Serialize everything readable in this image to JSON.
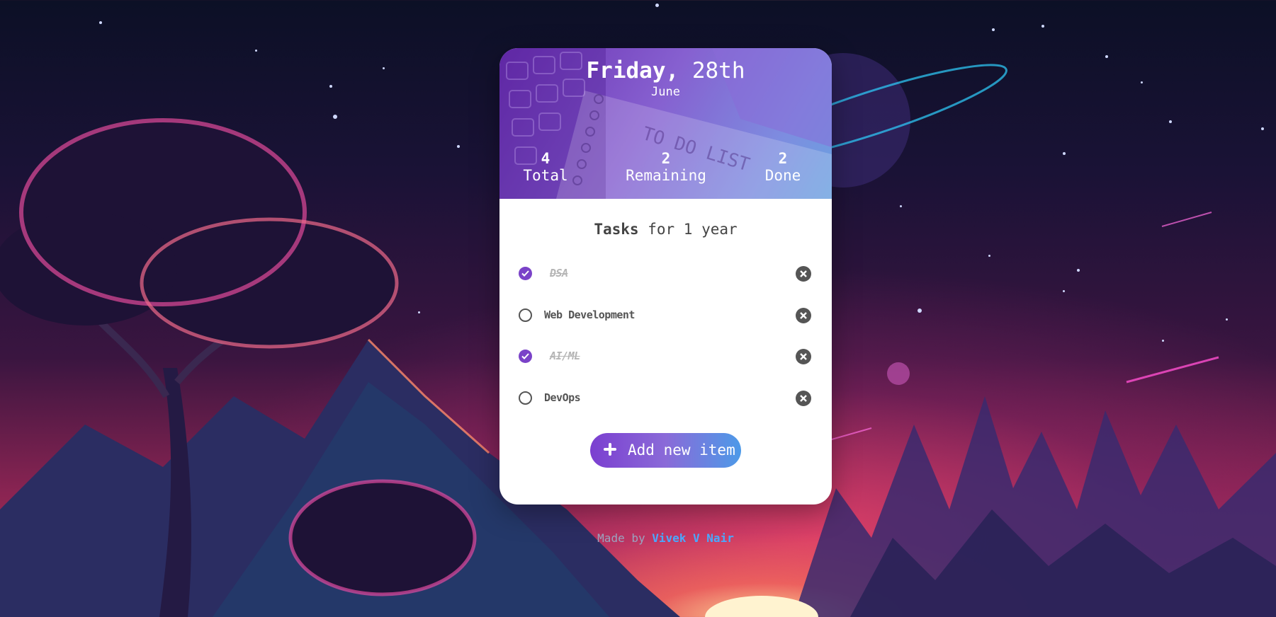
{
  "header": {
    "weekday": "Friday,",
    "day": "28th",
    "month": "June",
    "stats": [
      {
        "value": "4",
        "label": "Total"
      },
      {
        "value": "2",
        "label": "Remaining"
      },
      {
        "value": "2",
        "label": "Done"
      }
    ],
    "art_text": "TO DO LIST"
  },
  "list": {
    "title_bold": "Tasks",
    "title_rest": " for 1 year",
    "tasks": [
      {
        "label": "DSA",
        "done": true
      },
      {
        "label": "Web Development",
        "done": false
      },
      {
        "label": "AI/ML",
        "done": true
      },
      {
        "label": "DevOps",
        "done": false
      }
    ]
  },
  "add_button": {
    "label": "Add new item",
    "icon": "plus-icon"
  },
  "footer": {
    "prefix": "Made by ",
    "author": "Vivek V Nair"
  },
  "colors": {
    "accent": "#7a42c8",
    "link": "#4aa8ff",
    "delete": "#555555"
  }
}
